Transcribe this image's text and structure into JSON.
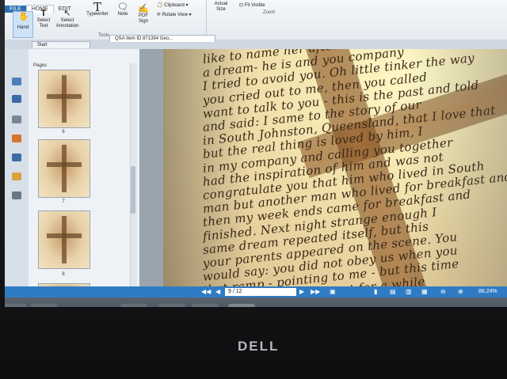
{
  "ribbon": {
    "tabs": [
      "FILE",
      "HOME",
      "EDIT"
    ],
    "tools": [
      "Hand",
      "Select Text",
      "Select Annotation",
      "Typewriter",
      "Note",
      "PDF Sign"
    ],
    "clipboard_label": "Clipboard",
    "rotate_label": "Rotate View",
    "actual_size_label": "Actual Size",
    "fit_visible_label": "Fit Visible",
    "group_tools": "Tools",
    "group_zoom": "Zoom"
  },
  "doc_tabs": {
    "start": "Start",
    "document": "QSA Item ID 871394 Geo..."
  },
  "panel": {
    "title": "Pages",
    "page_numbers": [
      "6",
      "7",
      "8"
    ]
  },
  "letter_lines": [
    "like to name her after a relation of ours. I had",
    "a dream- he is and you company",
    "I tried to avoid you. Oh little tinker the way",
    "you cried out to me, then you called",
    "want to talk to you - this is the past and told",
    "and said: I same to the story of our",
    "in South Johnston, Queensland, that I love that",
    "but the real thing is loved by him, I",
    "in my company and calling you together",
    "had the inspiration of him and was not",
    "congratulate you that him who lived in South",
    "man but another man who lived for breakfast and",
    "then my week ends came for breakfast and",
    "finished. Next night strange enough I",
    "same dream repeated itself, but this",
    "your parents appeared on the scene. You",
    "would say: you did not obey us when you",
    "that ramp - pointing to me - but this time",
    "obey; and you were sent for a while"
  ],
  "navigation": {
    "page_indicator": "9 / 12",
    "zoom": "88.24%"
  },
  "taskbar": {
    "apps": [
      "start-icon",
      "file-explorer-icon",
      "media-player-icon",
      "chrome-icon",
      "teamviewer-icon",
      "internet-explorer-icon",
      "word-icon",
      "folder-icon",
      "pdf-icon"
    ]
  },
  "monitor": {
    "brand": "DELL"
  },
  "colors": {
    "accent": "#2f7cc4",
    "paper": "#f4e6b0",
    "ink": "#3a2818"
  }
}
